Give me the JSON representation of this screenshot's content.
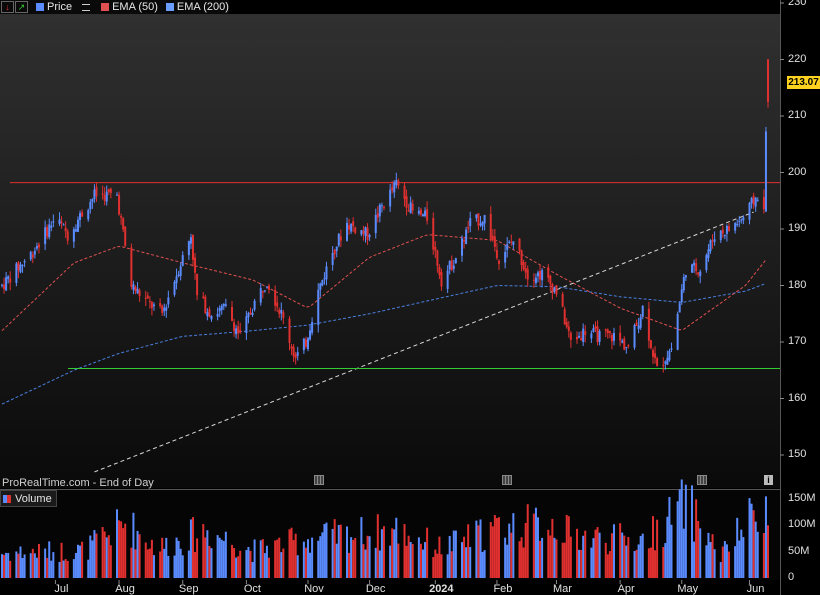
{
  "legend": {
    "items": [
      {
        "label": "Price",
        "color": "#5b8cff"
      },
      {
        "label": "EMA (50)",
        "color": "#e05050"
      },
      {
        "label": "EMA (200)",
        "color": "#6b9cff"
      }
    ]
  },
  "footer": "ProRealTime.com - End of Day",
  "volume_label": "Volume",
  "last_price": "213.07",
  "colors": {
    "up": "#5b8cff",
    "down": "#e0302f",
    "resistance": "#e03030",
    "support": "#33cc33",
    "ema50": "#e05050",
    "ema200": "#4a7fe0",
    "trend": "#d8d8d8"
  },
  "chart_data": {
    "type": "candlestick",
    "y_ticks": [
      "230",
      "220",
      "210",
      "200",
      "190",
      "180",
      "170",
      "160",
      "150"
    ],
    "ylim": [
      147,
      230
    ],
    "volume_ticks": [
      "150M",
      "100M",
      "50M",
      "0"
    ],
    "volume_ylim": [
      0,
      160
    ],
    "x_ticks": [
      "Jul",
      "Aug",
      "Sep",
      "Oct",
      "Nov",
      "Dec",
      "2024",
      "Feb",
      "Mar",
      "Apr",
      "May",
      "Jun"
    ],
    "horizontal_lines": {
      "resistance": 198.2,
      "support": 165.3
    },
    "trendline": {
      "from": [
        "2023-07-20",
        147.0
      ],
      "to": [
        "2024-06-05",
        193.0
      ]
    },
    "price_anchors": [
      [
        "2023-06-05",
        180
      ],
      [
        "2023-06-20",
        186
      ],
      [
        "2023-07-01",
        192
      ],
      [
        "2023-07-07",
        189
      ],
      [
        "2023-07-20",
        196
      ],
      [
        "2023-07-31",
        196
      ],
      [
        "2023-08-07",
        180
      ],
      [
        "2023-08-15",
        177
      ],
      [
        "2023-08-22",
        175
      ],
      [
        "2023-08-29",
        182
      ],
      [
        "2023-09-05",
        189
      ],
      [
        "2023-09-08",
        178
      ],
      [
        "2023-09-15",
        175
      ],
      [
        "2023-09-22",
        176
      ],
      [
        "2023-09-29",
        171
      ],
      [
        "2023-10-06",
        177
      ],
      [
        "2023-10-12",
        181
      ],
      [
        "2023-10-19",
        175
      ],
      [
        "2023-10-26",
        167
      ],
      [
        "2023-10-31",
        170
      ],
      [
        "2023-11-06",
        179
      ],
      [
        "2023-11-13",
        186
      ],
      [
        "2023-11-20",
        191
      ],
      [
        "2023-11-30",
        189
      ],
      [
        "2023-12-07",
        194
      ],
      [
        "2023-12-14",
        198
      ],
      [
        "2023-12-22",
        193
      ],
      [
        "2023-12-29",
        192
      ],
      [
        "2024-01-05",
        181
      ],
      [
        "2024-01-12",
        185
      ],
      [
        "2024-01-19",
        191
      ],
      [
        "2024-01-26",
        192
      ],
      [
        "2024-02-02",
        185
      ],
      [
        "2024-02-09",
        188
      ],
      [
        "2024-02-16",
        182
      ],
      [
        "2024-02-23",
        182
      ],
      [
        "2024-03-01",
        179
      ],
      [
        "2024-03-08",
        170
      ],
      [
        "2024-03-15",
        172
      ],
      [
        "2024-03-22",
        171
      ],
      [
        "2024-03-29",
        171
      ],
      [
        "2024-04-05",
        169
      ],
      [
        "2024-04-12",
        176
      ],
      [
        "2024-04-19",
        165
      ],
      [
        "2024-04-26",
        169
      ],
      [
        "2024-05-03",
        183
      ],
      [
        "2024-05-10",
        183
      ],
      [
        "2024-05-17",
        189
      ],
      [
        "2024-05-24",
        190
      ],
      [
        "2024-05-31",
        192
      ],
      [
        "2024-06-07",
        196
      ],
      [
        "2024-06-10",
        193
      ],
      [
        "2024-06-11",
        207
      ],
      [
        "2024-06-12",
        213
      ]
    ],
    "ema50_anchors": [
      [
        "2023-06-05",
        172
      ],
      [
        "2023-07-10",
        184
      ],
      [
        "2023-08-01",
        187
      ],
      [
        "2023-09-01",
        184
      ],
      [
        "2023-10-05",
        181
      ],
      [
        "2023-11-01",
        176
      ],
      [
        "2023-12-01",
        185
      ],
      [
        "2023-12-29",
        189
      ],
      [
        "2024-02-01",
        188
      ],
      [
        "2024-03-01",
        182
      ],
      [
        "2024-04-01",
        176
      ],
      [
        "2024-05-01",
        172
      ],
      [
        "2024-06-01",
        180
      ],
      [
        "2024-06-12",
        185
      ]
    ],
    "ema200_anchors": [
      [
        "2023-06-05",
        159
      ],
      [
        "2023-07-10",
        165
      ],
      [
        "2023-08-01",
        168
      ],
      [
        "2023-09-01",
        171
      ],
      [
        "2023-10-05",
        172
      ],
      [
        "2023-11-01",
        173
      ],
      [
        "2023-12-01",
        175
      ],
      [
        "2024-01-01",
        177.5
      ],
      [
        "2024-02-01",
        180
      ],
      [
        "2024-03-01",
        179.8
      ],
      [
        "2024-04-01",
        178
      ],
      [
        "2024-05-01",
        177
      ],
      [
        "2024-06-01",
        179
      ],
      [
        "2024-06-12",
        180.5
      ]
    ],
    "volume_anchors": [
      [
        "2023-06-05",
        50
      ],
      [
        "2023-07-15",
        55
      ],
      [
        "2023-08-04",
        110
      ],
      [
        "2023-08-20",
        60
      ],
      [
        "2023-09-12",
        95
      ],
      [
        "2023-10-05",
        55
      ],
      [
        "2023-11-03",
        80
      ],
      [
        "2023-12-15",
        95
      ],
      [
        "2024-01-05",
        60
      ],
      [
        "2024-02-02",
        100
      ],
      [
        "2024-03-01",
        110
      ],
      [
        "2024-03-08",
        85
      ],
      [
        "2024-04-12",
        75
      ],
      [
        "2024-04-19",
        95
      ],
      [
        "2024-05-03",
        150
      ],
      [
        "2024-05-20",
        45
      ],
      [
        "2024-06-11",
        155
      ],
      [
        "2024-06-12",
        95
      ]
    ]
  }
}
